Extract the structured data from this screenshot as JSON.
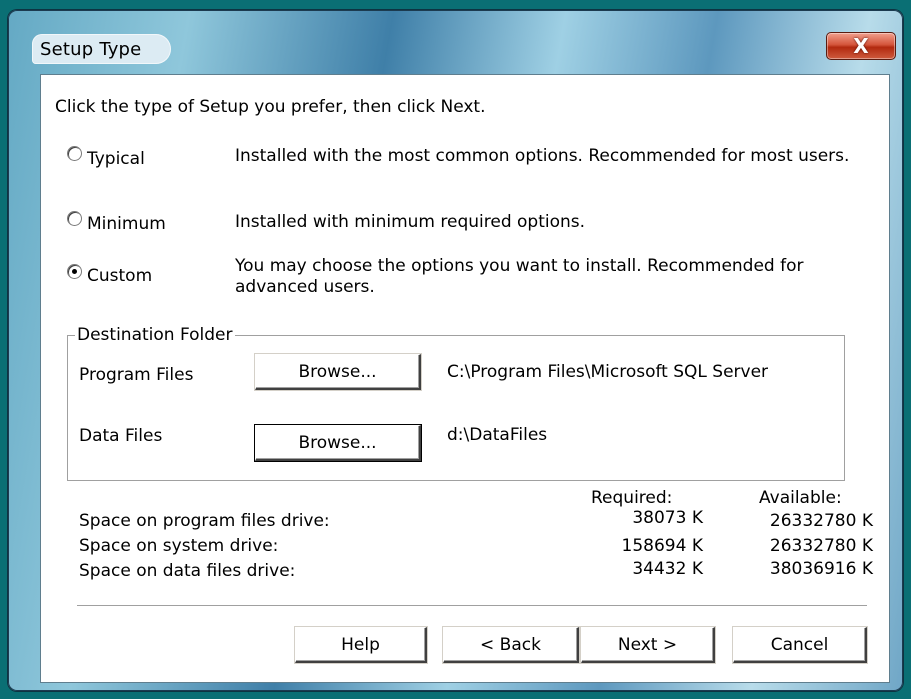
{
  "window": {
    "title": "Setup Type",
    "close_label": "X"
  },
  "instruction": "Click the type of Setup you prefer, then click Next.",
  "setup_options": [
    {
      "label": "Typical",
      "description": "Installed with the most common options. Recommended for most users.",
      "selected": false
    },
    {
      "label": "Minimum",
      "description": "Installed with minimum required options.",
      "selected": false
    },
    {
      "label": "Custom",
      "description_line1": "You may choose the options you want to install. Recommended for",
      "description_line2": "advanced users.",
      "selected": true
    }
  ],
  "destination": {
    "group_label": "Destination Folder",
    "program_files": {
      "label": "Program Files",
      "button": "Browse...",
      "path": "C:\\Program Files\\Microsoft SQL Server"
    },
    "data_files": {
      "label": "Data Files",
      "button": "Browse...",
      "path": "d:\\DataFiles"
    }
  },
  "space": {
    "required_header": "Required:",
    "available_header": "Available:",
    "rows": [
      {
        "label": "Space on program files drive:",
        "required": "38073 K",
        "available": "26332780 K"
      },
      {
        "label": "Space on system drive:",
        "required": "158694 K",
        "available": "26332780 K"
      },
      {
        "label": "Space on data files drive:",
        "required": "34432 K",
        "available": "38036916 K"
      }
    ]
  },
  "buttons": {
    "help": "Help",
    "back": "< Back",
    "next": "Next >",
    "cancel": "Cancel"
  }
}
